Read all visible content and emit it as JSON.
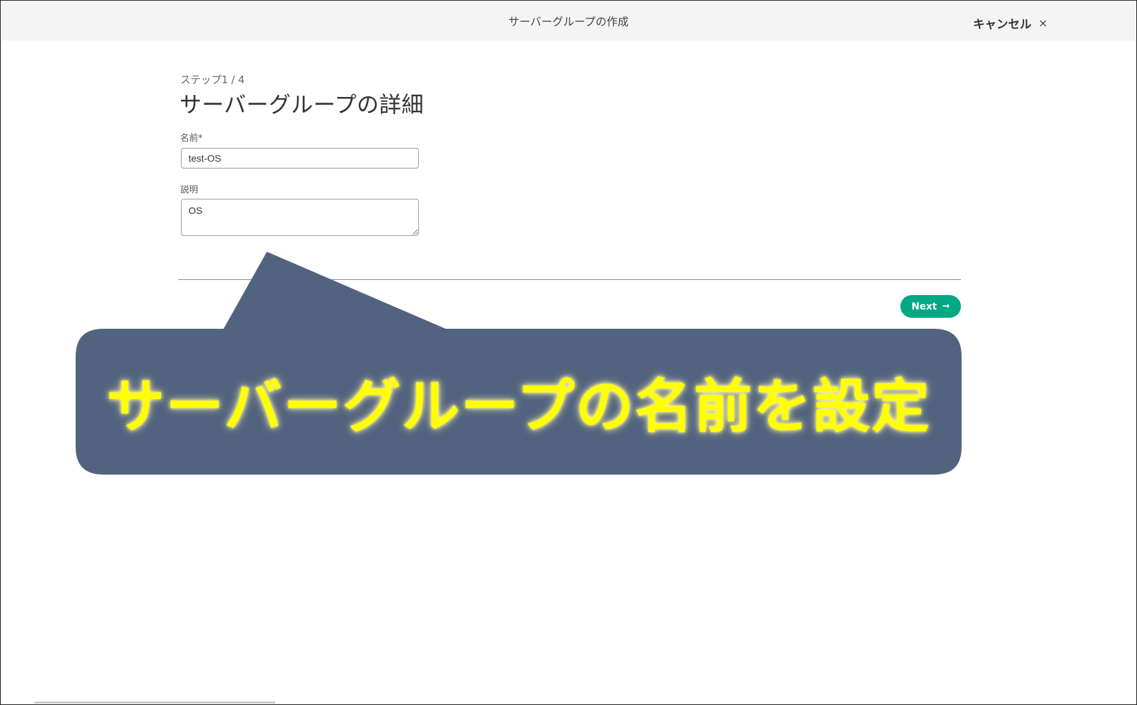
{
  "window": {
    "title": "サーバーグループの作成",
    "cancel_label": "キャンセル",
    "close_symbol": "×"
  },
  "wizard": {
    "step_label": "ステップ1 / 4",
    "heading": "サーバーグループの詳細"
  },
  "form": {
    "name_label": "名前*",
    "name_value": "test-OS",
    "description_label": "説明",
    "description_value": "OS"
  },
  "actions": {
    "next_label": "Next",
    "next_arrow": "→"
  },
  "callout": {
    "text": "サーバーグループの名前を設定",
    "fill_color": "#52637f",
    "text_color": "#ffff00"
  },
  "colors": {
    "accent": "#01a982",
    "topbar": "#f4f4f4"
  }
}
